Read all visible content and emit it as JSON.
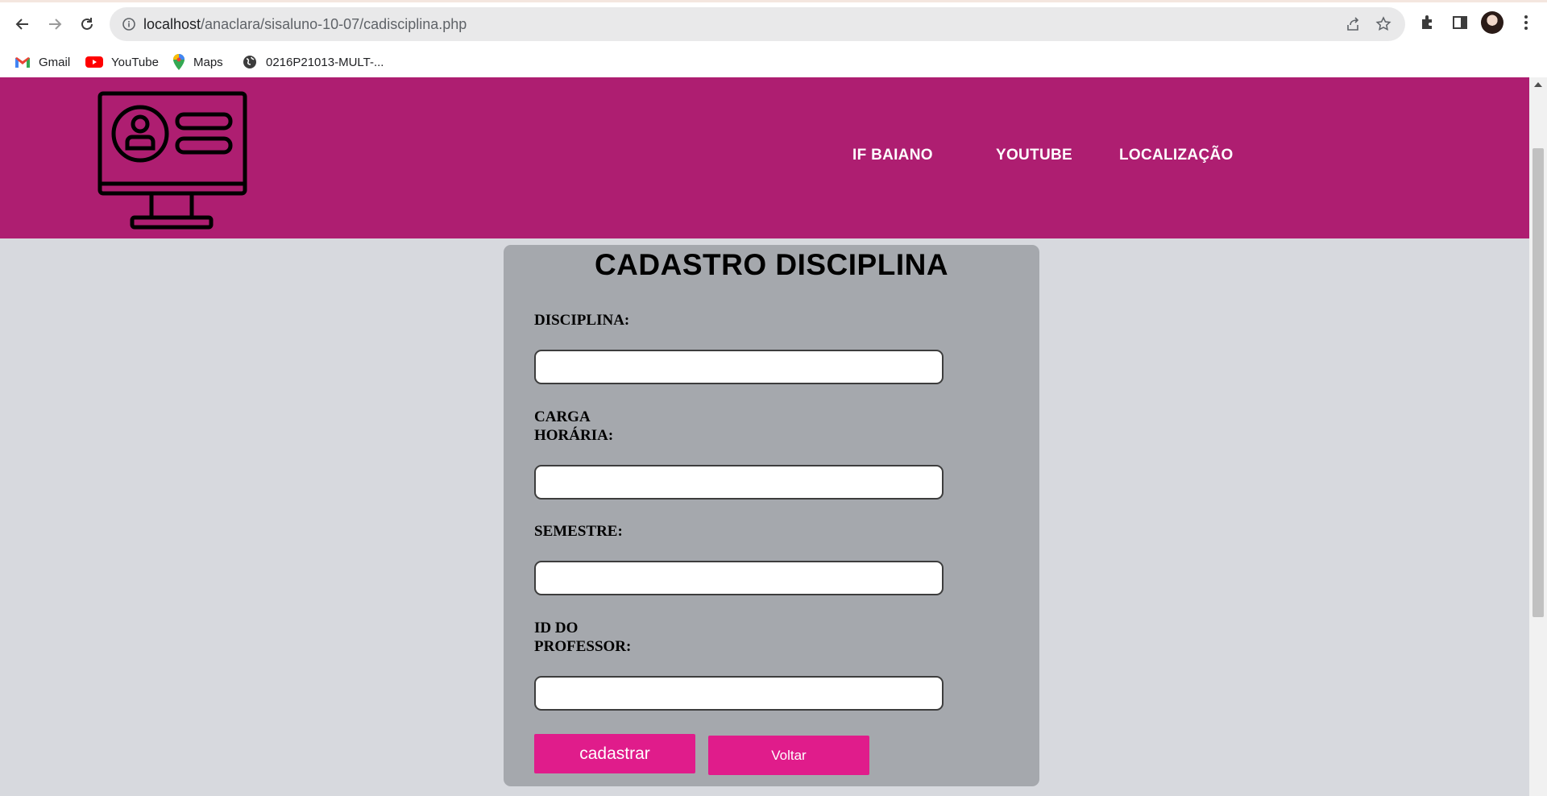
{
  "browser": {
    "url_host": "localhost",
    "url_path": "/anaclara/sisaluno-10-07/cadisciplina.php",
    "bookmarks": [
      {
        "label": "Gmail",
        "icon": "gmail-icon"
      },
      {
        "label": "YouTube",
        "icon": "youtube-icon"
      },
      {
        "label": "Maps",
        "icon": "maps-icon"
      },
      {
        "label": "0216P21013-MULT-...",
        "icon": "globe-icon"
      }
    ]
  },
  "header": {
    "logo_icon": "computer-user-profile-icon",
    "nav": [
      "IF BAIANO",
      "YOUTUBE",
      "LOCALIZAÇÃO"
    ]
  },
  "form": {
    "title": "CADASTRO DISCIPLINA",
    "fields": [
      {
        "label_line1": "DISCIPLINA:",
        "label_line2": "",
        "value": ""
      },
      {
        "label_line1": "CARGA",
        "label_line2": "HORÁRIA:",
        "value": ""
      },
      {
        "label_line1": "SEMESTRE:",
        "label_line2": "",
        "value": ""
      },
      {
        "label_line1": "ID DO",
        "label_line2": "PROFESSOR:",
        "value": ""
      }
    ],
    "submit_label": "cadastrar",
    "back_label": "Voltar"
  },
  "colors": {
    "header_bg": "#ae1e71",
    "page_bg": "#d7d9de",
    "card_bg": "#a5a8ad",
    "button_bg": "#e01c8b"
  }
}
